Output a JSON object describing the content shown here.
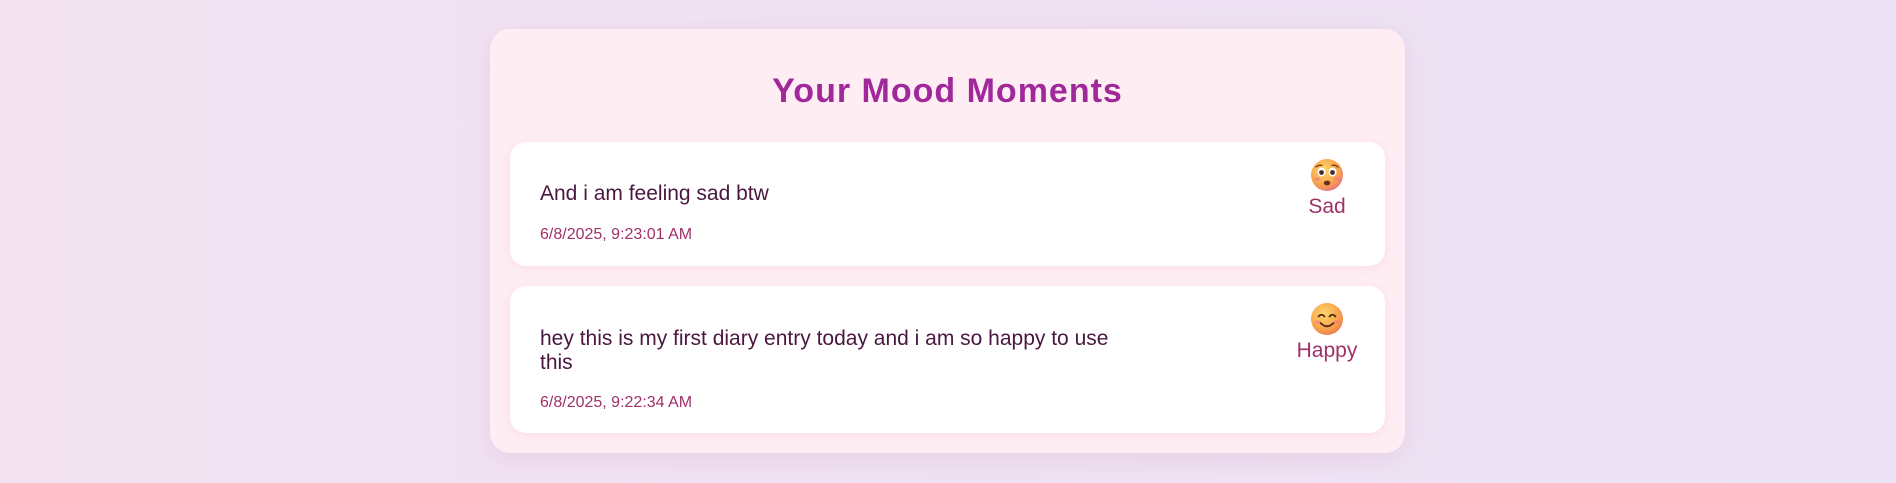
{
  "page": {
    "title": "Your Mood Moments"
  },
  "entries": [
    {
      "text": "And i am feeling sad btw",
      "date": "6/8/2025, 9:23:01 AM",
      "mood": "Sad",
      "mood_icon": "anxious-face-icon"
    },
    {
      "text": "hey this is my first diary entry today and i am so happy to use this",
      "date": "6/8/2025, 9:22:34 AM",
      "mood": "Happy",
      "mood_icon": "smiling-face-icon"
    }
  ],
  "colors": {
    "title": "#a0289a",
    "text": "#4a1740",
    "accent": "#a0306a",
    "panel": "#ffedf4"
  }
}
